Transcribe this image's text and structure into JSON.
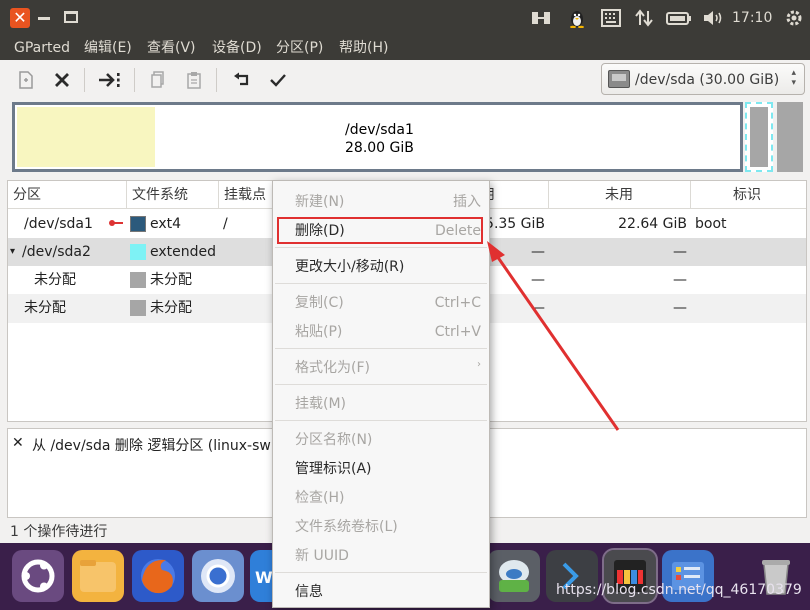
{
  "window": {
    "close_glyph": "✕"
  },
  "top_panel": {
    "clock": "17:10",
    "tray_icons": [
      "network-icon",
      "tux-icon",
      "keyboard-icon",
      "transfer-icon",
      "battery-icon",
      "volume-icon"
    ]
  },
  "menubar": {
    "items": [
      "GParted",
      "编辑(E)",
      "查看(V)",
      "设备(D)",
      "分区(P)",
      "帮助(H)"
    ]
  },
  "toolbar": {
    "device_label": "/dev/sda   (30.00 GiB)",
    "device_arrows": "▴▾"
  },
  "disk_map": {
    "partition_name": "/dev/sda1",
    "partition_size": "28.00 GiB"
  },
  "table": {
    "headers": [
      "分区",
      "文件系统",
      "挂载点",
      "",
      "用",
      "未用",
      "标识"
    ],
    "rows": [
      {
        "partition": "/dev/sda1",
        "fs": "ext4",
        "mount": "/",
        "used": "5.35 GiB",
        "unused": "22.64 GiB",
        "flags": "boot",
        "swatch": "#2c5a7c"
      },
      {
        "partition": "/dev/sda2",
        "fs": "extended",
        "mount": "",
        "used": "—",
        "unused": "—",
        "flags": "",
        "swatch": "#7ef2f5",
        "expander": "▾"
      },
      {
        "partition": "未分配",
        "fs": "未分配",
        "mount": "",
        "used": "—",
        "unused": "—",
        "flags": "",
        "swatch": "#a6a6a6"
      },
      {
        "partition": "未分配",
        "fs": "未分配",
        "mount": "",
        "used": "—",
        "unused": "—",
        "flags": "",
        "swatch": "#a6a6a6"
      }
    ]
  },
  "pending_ops": {
    "close_glyph": "✕",
    "items": [
      "从 /dev/sda 删除 逻辑分区 (linux-sw"
    ]
  },
  "status": {
    "text": "1 个操作待进行"
  },
  "context_menu": {
    "items": [
      {
        "label": "新建(N)",
        "accel": "插入",
        "enabled": false
      },
      {
        "label": "删除(D)",
        "accel": "Delete",
        "enabled": true,
        "highlighted": true
      },
      {
        "label": "更改大小/移动(R)",
        "accel": "",
        "enabled": true
      },
      {
        "label": "复制(C)",
        "accel": "Ctrl+C",
        "enabled": false
      },
      {
        "label": "粘贴(P)",
        "accel": "Ctrl+V",
        "enabled": false
      },
      {
        "label": "格式化为(F)",
        "accel": "›",
        "enabled": false
      },
      {
        "label": "挂载(M)",
        "accel": "",
        "enabled": false
      },
      {
        "label": "分区名称(N)",
        "accel": "",
        "enabled": false
      },
      {
        "label": "管理标识(A)",
        "accel": "",
        "enabled": true
      },
      {
        "label": "检查(H)",
        "accel": "",
        "enabled": false
      },
      {
        "label": "文件系统卷标(L)",
        "accel": "",
        "enabled": false
      },
      {
        "label": "新 UUID",
        "accel": "",
        "enabled": false
      },
      {
        "label": "信息",
        "accel": "",
        "enabled": true
      }
    ]
  },
  "dock": {
    "icons": [
      "ubuntu-logo-icon",
      "files-icon",
      "firefox-icon",
      "chromium-icon",
      "libreoffice-writer-icon",
      "software-updater-icon",
      "terminal-icon",
      "gparted-icon",
      "system-settings-icon",
      "trash-icon"
    ]
  },
  "watermark": "https://blog.csdn.net/qq_46170379",
  "colors": {
    "accent": "#e95420",
    "panel": "#3c3b37",
    "dock": "#3a1f4a",
    "annotation_red": "#e03030"
  }
}
